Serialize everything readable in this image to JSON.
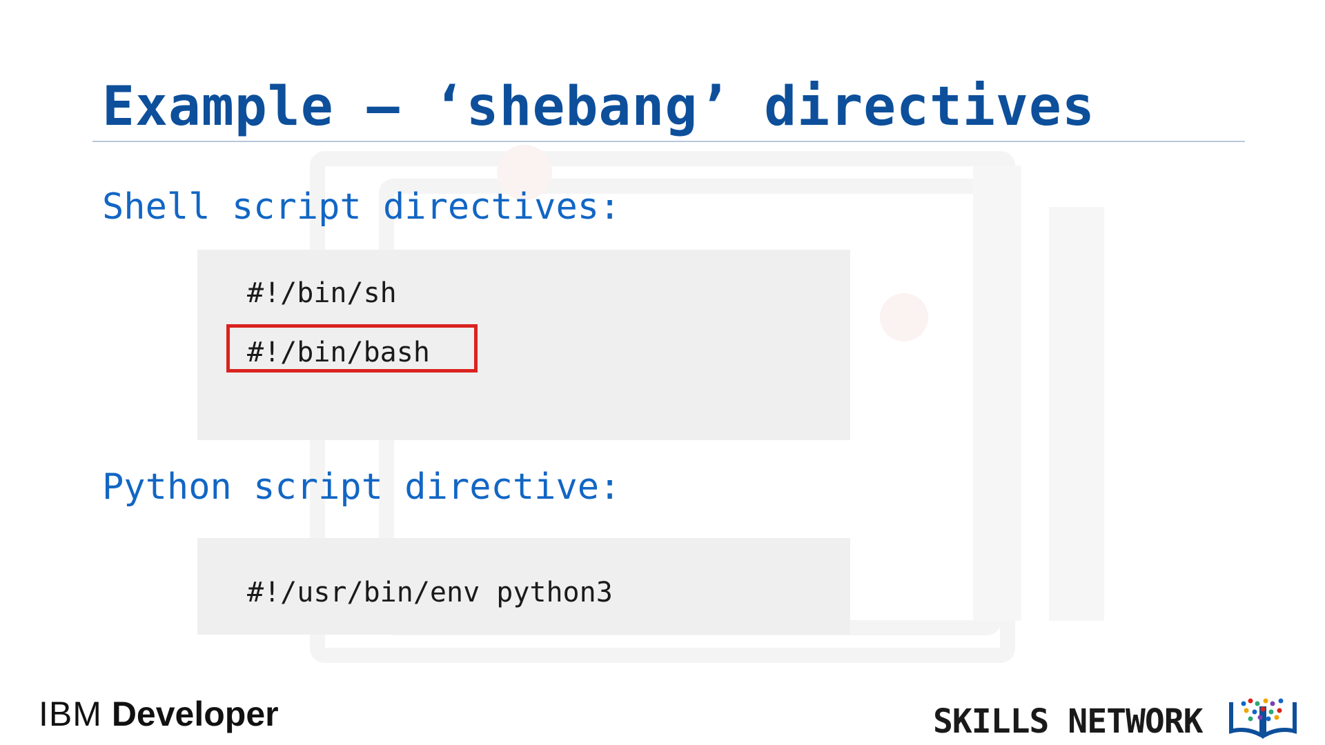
{
  "slide": {
    "title": "Example – ‘shebang’ directives"
  },
  "sections": [
    {
      "heading": "Shell script directives:",
      "code_lines": [
        "#!/bin/sh",
        "#!/bin/bash"
      ],
      "highlighted_line": "#!/bin/bash"
    },
    {
      "heading": "Python script directive:",
      "code_lines": [
        "#!/usr/bin/env python3"
      ]
    }
  ],
  "footer": {
    "brand_prefix": "IBM",
    "brand_suffix": "Developer",
    "skills_network": "SKILLS NETWORK"
  },
  "colors": {
    "title": "#0d4f9a",
    "heading": "#1266c4",
    "highlight": "#d9231f",
    "code_background": "#efefef"
  },
  "icons": {
    "skills_network_logo": "book-dots-icon"
  }
}
